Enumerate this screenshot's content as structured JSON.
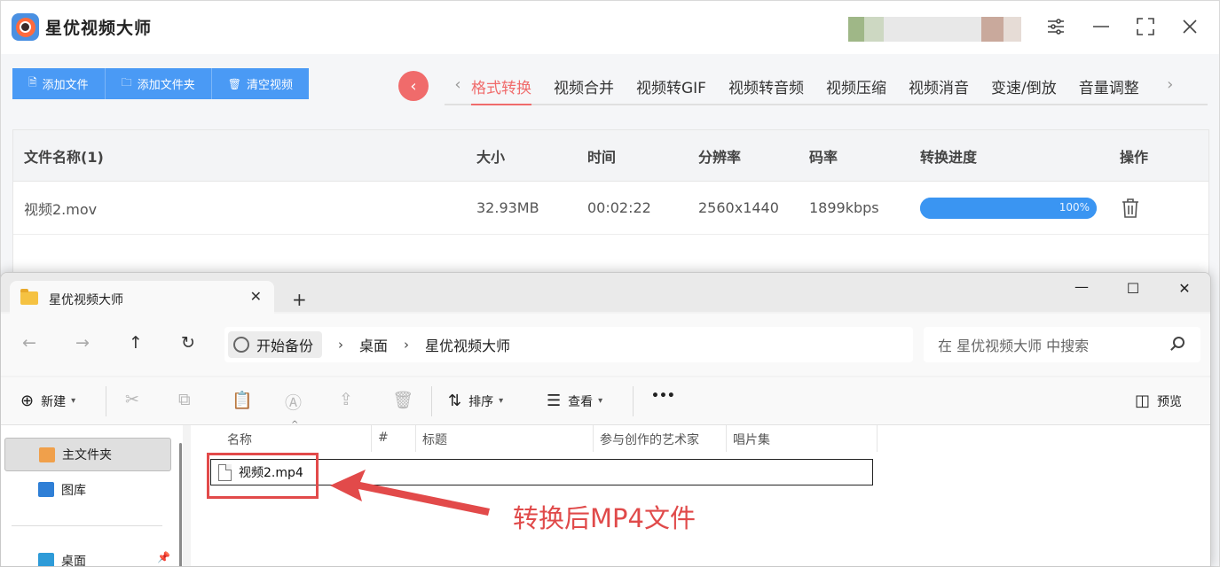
{
  "app": {
    "title": "星优视频大师",
    "toolbar": [
      {
        "icon": "file-icon",
        "label": "添加文件"
      },
      {
        "icon": "folder-icon",
        "label": "添加文件夹"
      },
      {
        "icon": "trash-icon",
        "label": "清空视频"
      }
    ],
    "tabs": [
      "格式转换",
      "视频合并",
      "视频转GIF",
      "视频转音频",
      "视频压缩",
      "视频消音",
      "变速/倒放",
      "音量调整"
    ],
    "active_tab": "格式转换",
    "table": {
      "headers": [
        "文件名称(1)",
        "大小",
        "时间",
        "分辨率",
        "码率",
        "转换进度",
        "操作"
      ],
      "rows": [
        {
          "name": "视频2.mov",
          "size": "32.93MB",
          "duration": "00:02:22",
          "resolution": "2560x1440",
          "bitrate": "1899kbps",
          "progress": 1.0,
          "progress_label": "100%"
        }
      ]
    },
    "colors": {
      "accent_blue": "#4a9af5",
      "accent_red": "#f06b6b"
    }
  },
  "explorer": {
    "tab_title": "星优视频大师",
    "breadcrumb": [
      "开始备份",
      "桌面",
      "星优视频大师"
    ],
    "search_placeholder": "在 星优视频大师 中搜索",
    "commands": {
      "new": "新建",
      "sort": "排序",
      "view": "查看",
      "more": "•••",
      "preview": "预览"
    },
    "nav_items": [
      "主文件夹",
      "图库",
      "桌面"
    ],
    "columns": [
      "名称",
      "#",
      "标题",
      "参与创作的艺术家",
      "唱片集"
    ],
    "files": [
      {
        "name": "视频2.mp4"
      }
    ]
  },
  "annotation": {
    "text": "转换后MP4文件",
    "color": "#e04a4a"
  }
}
